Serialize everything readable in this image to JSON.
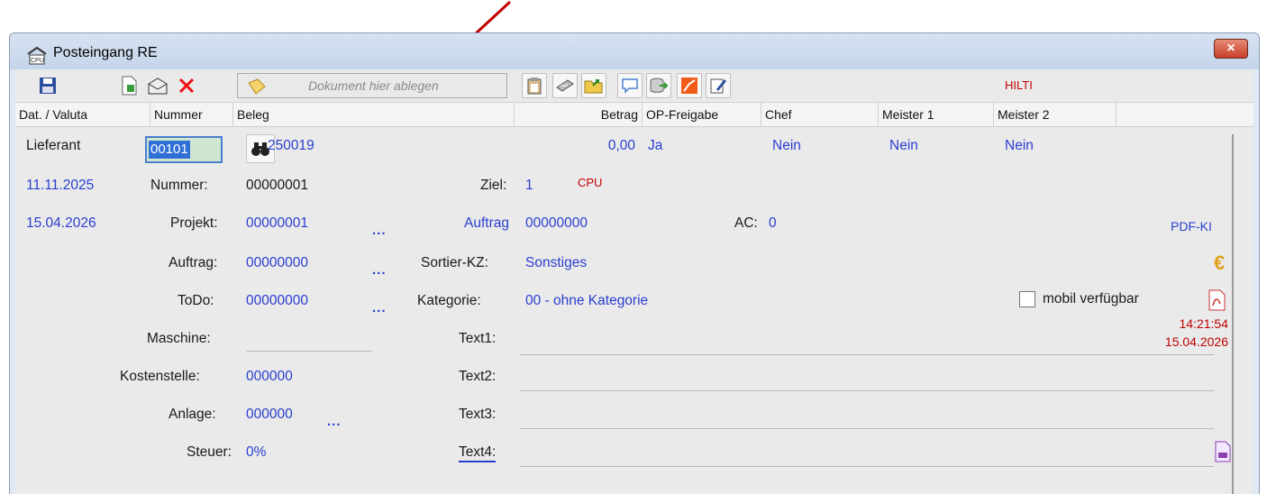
{
  "window": {
    "title": "Posteingang RE",
    "close_label": "×"
  },
  "toolbar": {
    "drop_zone_label": "Dokument hier ablegen",
    "supplier_tag": "HILTI"
  },
  "columns": [
    "Dat. / Valuta",
    "Nummer",
    "Beleg",
    "Betrag",
    "OP-Freigabe",
    "Chef",
    "Meister 1",
    "Meister 2"
  ],
  "row": {
    "type_label": "Lieferant",
    "supplier_number": "00101",
    "beleg": "250019",
    "betrag": "0,00",
    "op_freigabe": "Ja",
    "chef": "Nein",
    "meister1": "Nein",
    "meister2": "Nein"
  },
  "dates": {
    "date1": "11.11.2025",
    "date2": "15.04.2026"
  },
  "fields": {
    "nummer_label": "Nummer:",
    "nummer_value": "00000001",
    "projekt_label": "Projekt:",
    "projekt_value": "00000001",
    "auftrag_label": "Auftrag:",
    "auftrag_value": "00000000",
    "todo_label": "ToDo:",
    "todo_value": "00000000",
    "maschine_label": "Maschine:",
    "kostenstelle_label": "Kostenstelle:",
    "kostenstelle_value": "000000",
    "anlage_label": "Anlage:",
    "anlage_value": "000000",
    "steuer_label": "Steuer:",
    "steuer_value": "0%",
    "ziel_label": "Ziel:",
    "ziel_value": "1",
    "cpu_label": "CPU",
    "auftrag2_label": "Auftrag",
    "auftrag2_value": "00000000",
    "ac_label": "AC:",
    "ac_value": "0",
    "sortier_label": "Sortier-KZ:",
    "sortier_value": "Sonstiges",
    "kategorie_label": "Kategorie:",
    "kategorie_value": "00 - ohne Kategorie",
    "text1_label": "Text1:",
    "text2_label": "Text2:",
    "text3_label": "Text3:",
    "text4_label": "Text4:",
    "dots": "..."
  },
  "side": {
    "pdf_ki": "PDF-KI",
    "mobil_label": "mobil verfügbar",
    "time": "14:21:54",
    "date": "15.04.2026"
  },
  "colors": {
    "blue_text": "#2a3fd0",
    "red_text": "#c00000",
    "arrow": "#c00000"
  }
}
